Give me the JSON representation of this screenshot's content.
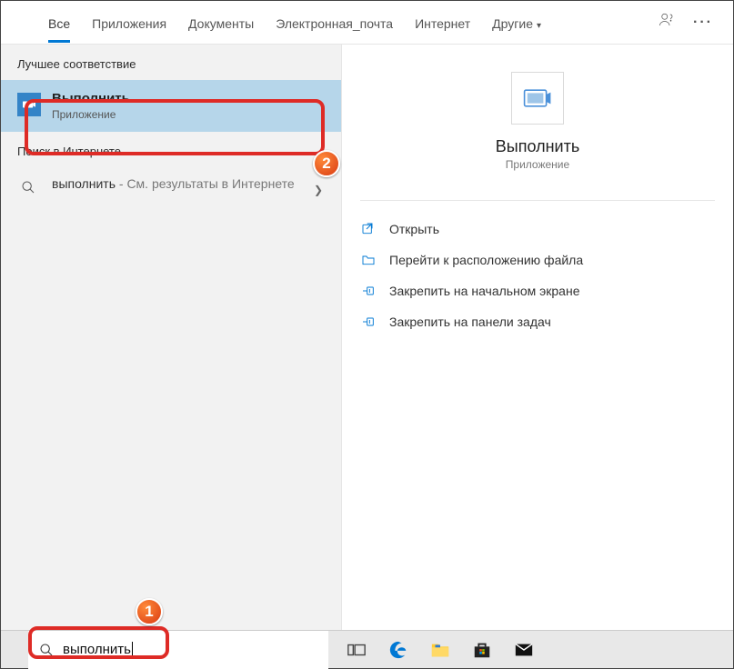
{
  "tabs": {
    "all": "Все",
    "apps": "Приложения",
    "docs": "Документы",
    "email": "Электронная_почта",
    "internet": "Интернет",
    "other": "Другие"
  },
  "left": {
    "best_match_label": "Лучшее соответствие",
    "result": {
      "title": "Выполнить",
      "subtitle": "Приложение"
    },
    "web_label": "Поиск в Интернете",
    "web_query": "выполнить",
    "web_suffix": " - См. результаты в Интернете"
  },
  "right": {
    "title": "Выполнить",
    "subtitle": "Приложение",
    "actions": {
      "open": "Открыть",
      "file_location": "Перейти к расположению файла",
      "pin_start": "Закрепить на начальном экране",
      "pin_taskbar": "Закрепить на панели задач"
    }
  },
  "search": {
    "value": "выполнить"
  },
  "badges": {
    "one": "1",
    "two": "2"
  }
}
